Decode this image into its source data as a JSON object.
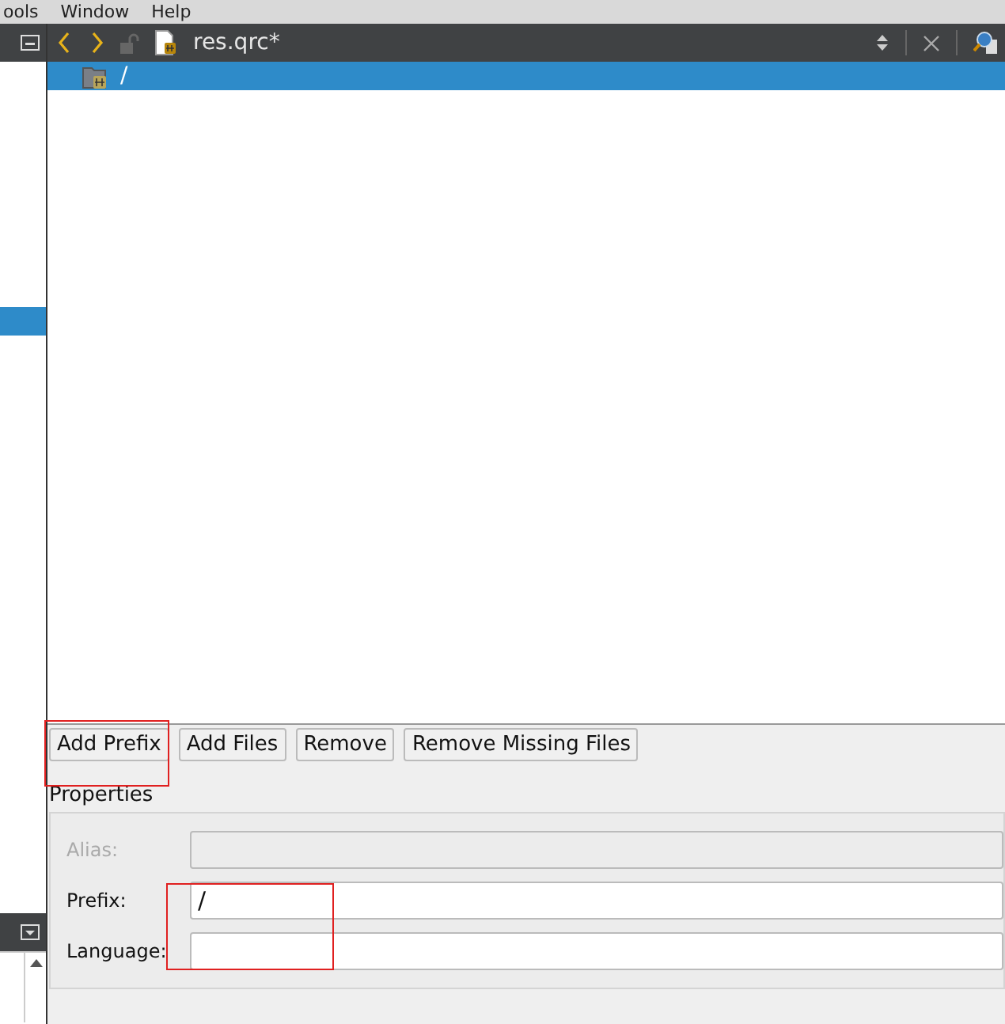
{
  "menu_bar": {
    "items": [
      "ools",
      "Window",
      "Help"
    ]
  },
  "editor_toolbar": {
    "file_name": "res.qrc*"
  },
  "tree": {
    "items": [
      {
        "label": "/",
        "selected": true
      }
    ]
  },
  "buttons": [
    "Add Prefix",
    "Add Files",
    "Remove",
    "Remove Missing Files"
  ],
  "properties": {
    "title": "Properties",
    "fields": [
      {
        "label": "Alias:",
        "disabled": true
      },
      {
        "label": "Prefix:",
        "value": "/",
        "disabled": false
      },
      {
        "label": "Language:",
        "disabled": false
      }
    ]
  },
  "annotations": [
    {
      "kind": "highlight-box"
    },
    {
      "kind": "highlight-box"
    }
  ]
}
